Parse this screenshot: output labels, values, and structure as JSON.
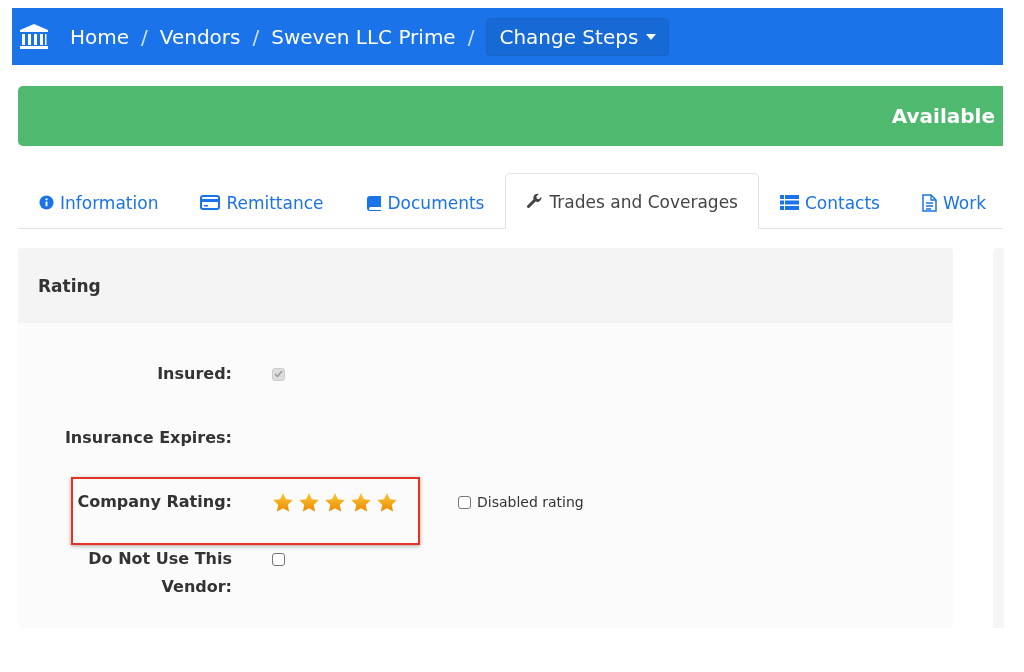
{
  "breadcrumb": [
    {
      "label": "Home",
      "separator": "/"
    },
    {
      "label": "Vendors",
      "separator": "/"
    },
    {
      "label": "Sweven LLC Prime",
      "separator": "/"
    }
  ],
  "steps_button": {
    "label": "Change Steps"
  },
  "banner": {
    "status": "Available"
  },
  "tabs": [
    {
      "label": "Information",
      "kind": "info",
      "selected": false
    },
    {
      "label": "Remittance",
      "kind": "card",
      "selected": false
    },
    {
      "label": "Documents",
      "kind": "book",
      "selected": false
    },
    {
      "label": "Trades and Coverages",
      "kind": "wrench",
      "selected": true
    },
    {
      "label": "Contacts",
      "kind": "list",
      "selected": false
    },
    {
      "label": "Work",
      "kind": "file",
      "selected": false
    }
  ],
  "panel": {
    "title": "Rating",
    "fields": [
      {
        "kind": "checkbox",
        "label": "Insured:",
        "checked": true,
        "disabled": true
      },
      {
        "kind": "text",
        "label": "Insurance Expires:"
      },
      {
        "kind": "stars",
        "label": "Company Rating:",
        "stars": 5,
        "highlighted": true,
        "option": {
          "label": "Disabled rating",
          "checked": false
        }
      },
      {
        "kind": "checkbox",
        "label": "Do Not Use This Vendor:",
        "checked": false,
        "disabled": false
      }
    ]
  }
}
